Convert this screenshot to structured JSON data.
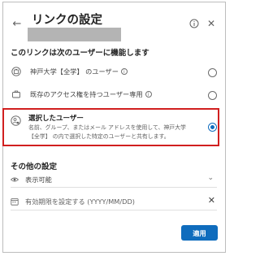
{
  "dialog": {
    "title": "リンクの設定",
    "section_share_with": "このリンクは次のユーザーに機能します",
    "options": [
      {
        "label": "神戸大学【全学】 のユーザー",
        "selected": false,
        "has_info": true
      },
      {
        "label": "既存のアクセス権を持つユーザー専用",
        "selected": false,
        "has_info": true
      },
      {
        "label": "選択したユーザー",
        "description": "名前、グループ、またはメール アドレスを使用して、神戸大学【全学】 の内で選択した特定のユーザーと共有します。",
        "selected": true
      }
    ],
    "section_other": "その他の設定",
    "permission": {
      "value": "表示可能"
    },
    "expiry": {
      "placeholder": "有効期限を設定する (YYYY/MM/DD)"
    },
    "apply_label": "適用",
    "info_glyph": "i",
    "close_glyph": "✕",
    "back_glyph": "←",
    "chevron_glyph": "⌄",
    "accent_color": "#0f6cbd",
    "highlight_color": "#d11f1f"
  }
}
